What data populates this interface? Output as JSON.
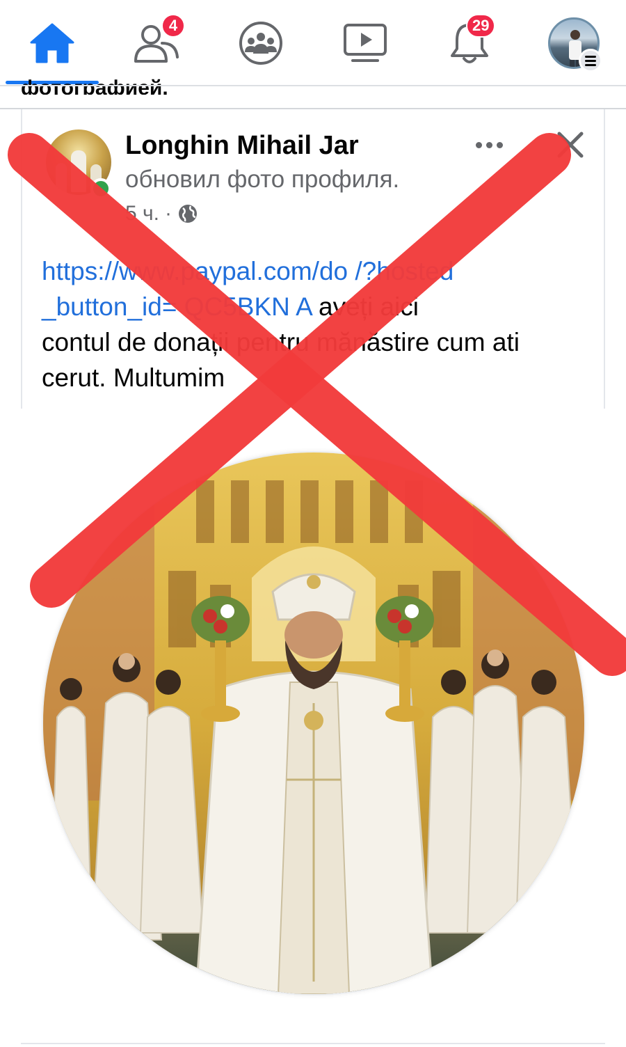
{
  "nav": {
    "items": [
      {
        "name": "home",
        "icon": "home-icon",
        "active": true
      },
      {
        "name": "friends",
        "icon": "friends-icon",
        "badge": "4"
      },
      {
        "name": "groups",
        "icon": "groups-icon"
      },
      {
        "name": "watch",
        "icon": "watch-icon"
      },
      {
        "name": "notifications",
        "icon": "bell-icon",
        "badge": "29"
      },
      {
        "name": "profile-menu",
        "icon": "avatar-menu-icon"
      }
    ],
    "accent_color": "#1877f2",
    "badge_color": "#f02849"
  },
  "previous_post": {
    "clipped_text": "фотографией."
  },
  "post": {
    "author": "Longhin Mihail Jar",
    "action": "обновил фото профиля.",
    "time": "5 ч.",
    "separator": "·",
    "privacy_icon": "globe-icon",
    "online": true,
    "text": {
      "link": "https://www.paypal.com/donate/?hosted_button_id=...QC5BKN...A",
      "link_visible": "https://       paypal.com/do           /?hosted\n_button_id=      QC5BKN       A",
      "link_line1": "https://www.paypal.com/do     /?hosted",
      "link_line2": "_button_id=     QC5BKN    A",
      "after_link_line2": " aveți aici",
      "line3": "contul de donații pentru mănăstire cum ati",
      "line4": "cerut. Multumim"
    },
    "photo_description_icon": "profile-photo"
  },
  "overlay": {
    "type": "red-x",
    "color": "#f23b3b"
  }
}
